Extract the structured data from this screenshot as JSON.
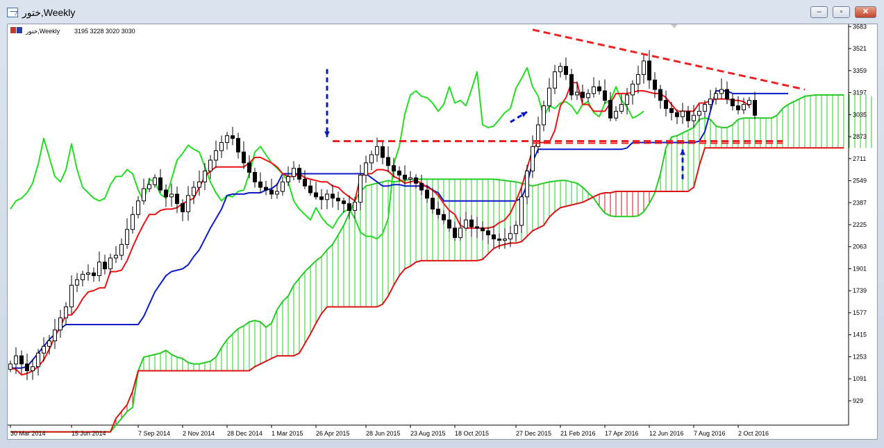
{
  "window": {
    "title": "ختور,Weekly",
    "buttons": {
      "minimize": "‒",
      "maximize": "▫",
      "close": "✕"
    }
  },
  "chart_header": {
    "symbol": "ختور,Weekly",
    "ohlc": "3195 3228 3020 3030"
  },
  "colors": {
    "background": "#ffffff",
    "candle_up": "#ffffff",
    "candle_down": "#000000",
    "tenkan": "#ee1111",
    "kijun": "#0a18c8",
    "chikou": "#22dd22",
    "span_a": "#22cc22",
    "span_b": "#dd1111",
    "annotation_red": "#ee2222",
    "annotation_blue": "#0a18c8"
  },
  "chart_data": {
    "type": "candlestick",
    "ylim": [
      750,
      3700
    ],
    "y_ticks": [
      929,
      1091,
      1253,
      1415,
      1577,
      1739,
      1901,
      2063,
      2225,
      2387,
      2549,
      2711,
      2873,
      3035,
      3197,
      3359,
      3521,
      3683
    ],
    "x_ticks": [
      "30 Mar 2014",
      "15 Jun 2014",
      "7 Sep 2014",
      "2 Nov 2014",
      "28 Dec 2014",
      "1 Mar 2015",
      "26 Apr 2015",
      "28 Jun 2015",
      "23 Aug 2015",
      "18 Oct 2015",
      "27 Dec 2015",
      "21 Feb 2016",
      "17 Apr 2016",
      "12 Jun 2016",
      "7 Aug 2016",
      "2 Oct 2016"
    ],
    "x_tick_index": [
      0,
      11,
      23,
      31,
      39,
      47,
      55,
      64,
      72,
      80,
      91,
      99,
      107,
      115,
      123,
      131
    ],
    "closes": [
      1200,
      1260,
      1200,
      1150,
      1180,
      1280,
      1330,
      1370,
      1450,
      1540,
      1620,
      1780,
      1820,
      1860,
      1870,
      1850,
      1950,
      1900,
      1980,
      2000,
      2080,
      2190,
      2300,
      2400,
      2490,
      2520,
      2570,
      2480,
      2430,
      2450,
      2380,
      2320,
      2440,
      2500,
      2540,
      2620,
      2700,
      2770,
      2830,
      2880,
      2860,
      2760,
      2680,
      2610,
      2540,
      2500,
      2480,
      2450,
      2470,
      2540,
      2580,
      2640,
      2560,
      2510,
      2460,
      2430,
      2410,
      2450,
      2420,
      2400,
      2380,
      2330,
      2390,
      2590,
      2680,
      2740,
      2800,
      2720,
      2660,
      2620,
      2590,
      2560,
      2570,
      2530,
      2480,
      2420,
      2340,
      2300,
      2260,
      2200,
      2130,
      2200,
      2260,
      2210,
      2200,
      2180,
      2150,
      2120,
      2110,
      2120,
      2160,
      2220,
      2430,
      2620,
      2800,
      2960,
      3100,
      3230,
      3350,
      3390,
      3330,
      3180,
      3200,
      3160,
      3190,
      3240,
      3210,
      3140,
      3010,
      3060,
      3110,
      3180,
      3260,
      3330,
      3430,
      3290,
      3220,
      3140,
      3080,
      3050,
      3020,
      3060,
      2990,
      3030,
      3060,
      3110,
      3150,
      3190,
      3220,
      3150,
      3100,
      3070,
      3110,
      3140,
      3030
    ],
    "span_a": [
      700,
      700,
      700,
      700,
      700,
      700,
      700,
      700,
      700,
      700,
      700,
      700,
      700,
      700,
      700,
      700,
      700,
      700,
      700,
      750,
      800,
      850,
      880,
      1150,
      1250,
      1260,
      1270,
      1280,
      1300,
      1270,
      1250,
      1240,
      1210,
      1200,
      1200,
      1210,
      1220,
      1250,
      1320,
      1380,
      1420,
      1460,
      1480,
      1510,
      1520,
      1510,
      1470,
      1500,
      1600,
      1660,
      1700,
      1780,
      1830,
      1880,
      1920,
      1960,
      1990,
      2040,
      2080,
      2150,
      2220,
      2310,
      2400,
      2470,
      2510,
      2520,
      2530,
      2540,
      2550,
      2540,
      2545,
      2550,
      2560,
      2560,
      2560,
      2560,
      2560,
      2560,
      2560,
      2560,
      2560,
      2560,
      2560,
      2560,
      2560,
      2560,
      2560,
      2560,
      2555,
      2550,
      2545,
      2540,
      2530,
      2520,
      2510,
      2520,
      2530,
      2540,
      2545,
      2550,
      2550,
      2540,
      2530,
      2500,
      2460,
      2420,
      2360,
      2310,
      2290,
      2285,
      2285,
      2285,
      2285,
      2290,
      2320,
      2380,
      2460,
      2600,
      2790,
      2870,
      2880,
      2900,
      2920,
      2940,
      3000,
      3010,
      3000,
      2950,
      2940,
      2940,
      2960,
      3000,
      3010,
      3010,
      3010,
      3010,
      3010,
      3010,
      3030,
      3080,
      3110,
      3130,
      3150,
      3170,
      3175,
      3180,
      3180,
      3180,
      3180,
      3180,
      3180,
      3185,
      3190,
      3190,
      3185,
      3170
    ],
    "span_b": [
      700,
      700,
      700,
      700,
      700,
      700,
      700,
      700,
      700,
      700,
      700,
      700,
      700,
      700,
      700,
      700,
      700,
      700,
      700,
      800,
      850,
      900,
      1000,
      1150,
      1150,
      1150,
      1150,
      1150,
      1150,
      1150,
      1150,
      1150,
      1150,
      1150,
      1150,
      1150,
      1150,
      1150,
      1150,
      1150,
      1150,
      1150,
      1150,
      1150,
      1180,
      1200,
      1220,
      1240,
      1260,
      1260,
      1260,
      1260,
      1280,
      1350,
      1420,
      1500,
      1570,
      1620,
      1620,
      1620,
      1620,
      1620,
      1620,
      1620,
      1620,
      1620,
      1620,
      1640,
      1700,
      1780,
      1850,
      1900,
      1920,
      1950,
      1960,
      1960,
      1960,
      1960,
      1960,
      1960,
      1960,
      1960,
      1960,
      1960,
      1960,
      1970,
      2010,
      2050,
      2070,
      2080,
      2090,
      2090,
      2100,
      2140,
      2180,
      2200,
      2220,
      2280,
      2320,
      2350,
      2360,
      2370,
      2380,
      2390,
      2410,
      2430,
      2450,
      2460,
      2460,
      2470,
      2470,
      2470,
      2470,
      2470,
      2470,
      2470,
      2470,
      2470,
      2470,
      2470,
      2470,
      2470,
      2470,
      2500,
      2660,
      2790,
      2790,
      2790,
      2790,
      2790,
      2790,
      2790,
      2790,
      2790,
      2790,
      2790,
      2790,
      2790,
      2790,
      2790,
      2790,
      2790,
      2790,
      2790,
      2790,
      2790,
      2790,
      2790,
      2790,
      2790,
      2790,
      2790,
      2790,
      2790,
      2790,
      2790,
      2790,
      2790,
      2790,
      2790,
      2790
    ],
    "tenkan": [
      1170,
      1160,
      1120,
      1130,
      1150,
      1180,
      1230,
      1310,
      1400,
      1480,
      1560,
      1560,
      1610,
      1680,
      1730,
      1740,
      1760,
      1760,
      1880,
      1880,
      1890,
      1960,
      2060,
      2150,
      2230,
      2300,
      2300,
      2330,
      2340,
      2340,
      2350,
      2380,
      2400,
      2420,
      2500,
      2580,
      2620,
      2650,
      2650,
      2650,
      2650,
      2650,
      2650,
      2680,
      2720,
      2720,
      2700,
      2680,
      2650,
      2600,
      2580,
      2580,
      2600,
      2570,
      2560,
      2550,
      2540,
      2540,
      2510,
      2500,
      2460,
      2430,
      2400,
      2580,
      2600,
      2600,
      2630,
      2630,
      2620,
      2580,
      2560,
      2530,
      2540,
      2550,
      2530,
      2500,
      2480,
      2440,
      2380,
      2330,
      2300,
      2220,
      2200,
      2200,
      2200,
      2200,
      2200,
      2210,
      2240,
      2260,
      2310,
      2400,
      2500,
      2640,
      2780,
      2830,
      2830,
      2830,
      2920,
      3100,
      3160,
      3270,
      3270,
      3110,
      3110,
      3060,
      3060,
      3060,
      3120,
      3190,
      3190,
      3190,
      3200,
      3210,
      3210,
      3200,
      3190,
      3190,
      3160,
      3110,
      3060,
      3060,
      3060,
      3060,
      3120,
      3120,
      3140,
      3150,
      3150,
      3150,
      3140,
      3140,
      3130,
      3100
    ],
    "kijun": [
      1170,
      1170,
      1170,
      1180,
      1230,
      1280,
      1330,
      1380,
      1420,
      1460,
      1490,
      1490,
      1490,
      1490,
      1490,
      1490,
      1490,
      1490,
      1490,
      1490,
      1490,
      1490,
      1490,
      1490,
      1550,
      1640,
      1730,
      1790,
      1850,
      1880,
      1890,
      1900,
      1930,
      1990,
      2040,
      2120,
      2200,
      2270,
      2340,
      2440,
      2450,
      2450,
      2450,
      2460,
      2460,
      2460,
      2480,
      2490,
      2520,
      2600,
      2600,
      2600,
      2600,
      2600,
      2600,
      2600,
      2600,
      2600,
      2600,
      2600,
      2600,
      2600,
      2600,
      2600,
      2600,
      2570,
      2540,
      2510,
      2510,
      2520,
      2520,
      2510,
      2510,
      2510,
      2510,
      2510,
      2480,
      2460,
      2400,
      2400,
      2400,
      2400,
      2400,
      2400,
      2400,
      2400,
      2400,
      2400,
      2400,
      2400,
      2400,
      2400,
      2420,
      2520,
      2690,
      2780,
      2780,
      2780,
      2780,
      2780,
      2780,
      2780,
      2780,
      2780,
      2780,
      2780,
      2780,
      2780,
      2780,
      2780,
      2780,
      2790,
      2830,
      2830,
      2830,
      2830,
      2830,
      2830,
      2830,
      2830,
      2830,
      2830,
      2830,
      2830,
      2840,
      2910,
      3060,
      3210,
      3210,
      3210,
      3190,
      3190,
      3190,
      3190,
      3190,
      3190,
      3190,
      3190,
      3190,
      3190,
      3190
    ],
    "chikou": [
      2340,
      2400,
      2420,
      2460,
      2530,
      2670,
      2860,
      2720,
      2580,
      2540,
      2630,
      2820,
      2630,
      2500,
      2460,
      2420,
      2400,
      2420,
      2520,
      2580,
      2580,
      2630,
      2600,
      2480,
      2400,
      2560,
      2540,
      2450,
      2420,
      2560,
      2700,
      2750,
      2810,
      2780,
      2760,
      2650,
      2540,
      2460,
      2400,
      2440,
      2430,
      2470,
      2480,
      2600,
      2760,
      2800,
      2740,
      2680,
      2640,
      2600,
      2540,
      2400,
      2340,
      2300,
      2260,
      2350,
      2280,
      2230,
      2200,
      2270,
      2320,
      2340,
      2270,
      2170,
      2140,
      2140,
      2120,
      2160,
      2270,
      2670,
      2800,
      3040,
      3180,
      3210,
      3170,
      3160,
      3120,
      3060,
      3110,
      3240,
      3120,
      3140,
      3100,
      3220,
      3350,
      2960,
      2940,
      2950,
      3000,
      3050,
      3080,
      3230,
      3300,
      3380,
      3240,
      3170,
      3020,
      3100,
      3080,
      3120,
      3130,
      3100,
      3040,
      3110,
      3130,
      3050,
      3020,
      3120,
      3140,
      3240,
      3140,
      3090,
      3010,
      3030,
      3060
    ],
    "chikou_start": 0,
    "trendline": {
      "from_index": 94,
      "from_value": 3660,
      "to_index": 143,
      "to_value": 3220
    },
    "support_line": {
      "from_index": 58,
      "to_index": 139,
      "value": 2840
    },
    "support_line_2": {
      "from_index": 94,
      "to_index": 139,
      "value": 2825
    }
  }
}
